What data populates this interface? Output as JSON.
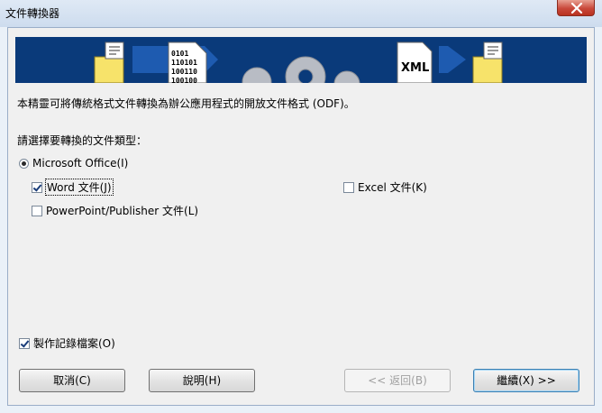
{
  "window": {
    "title": "文件轉換器"
  },
  "banner": {
    "left_code": [
      "0101",
      "110101",
      "100110",
      "100100"
    ],
    "xml_label": "XML",
    "colors": {
      "bg": "#0a3a7a",
      "arrow": "#1e5bb0",
      "folder": "#f7e36a",
      "gear": "#b8bcc4"
    }
  },
  "main": {
    "description": "本精靈可將傳統格式文件轉換為辦公應用程式的開放文件格式 (ODF)。",
    "prompt": "請選擇要轉換的文件類型：",
    "radio_label": "Microsoft Office(I)",
    "word_label": "Word 文件(J)",
    "excel_label": "Excel 文件(K)",
    "ppt_label": "PowerPoint/Publisher 文件(L)",
    "log_label": "製作記錄檔案(O)"
  },
  "state": {
    "radio_selected": true,
    "word_checked": true,
    "excel_checked": false,
    "ppt_checked": false,
    "log_checked": true
  },
  "buttons": {
    "cancel": "取消(C)",
    "help": "說明(H)",
    "back": "<< 返回(B)",
    "next": "繼續(X) >>"
  }
}
